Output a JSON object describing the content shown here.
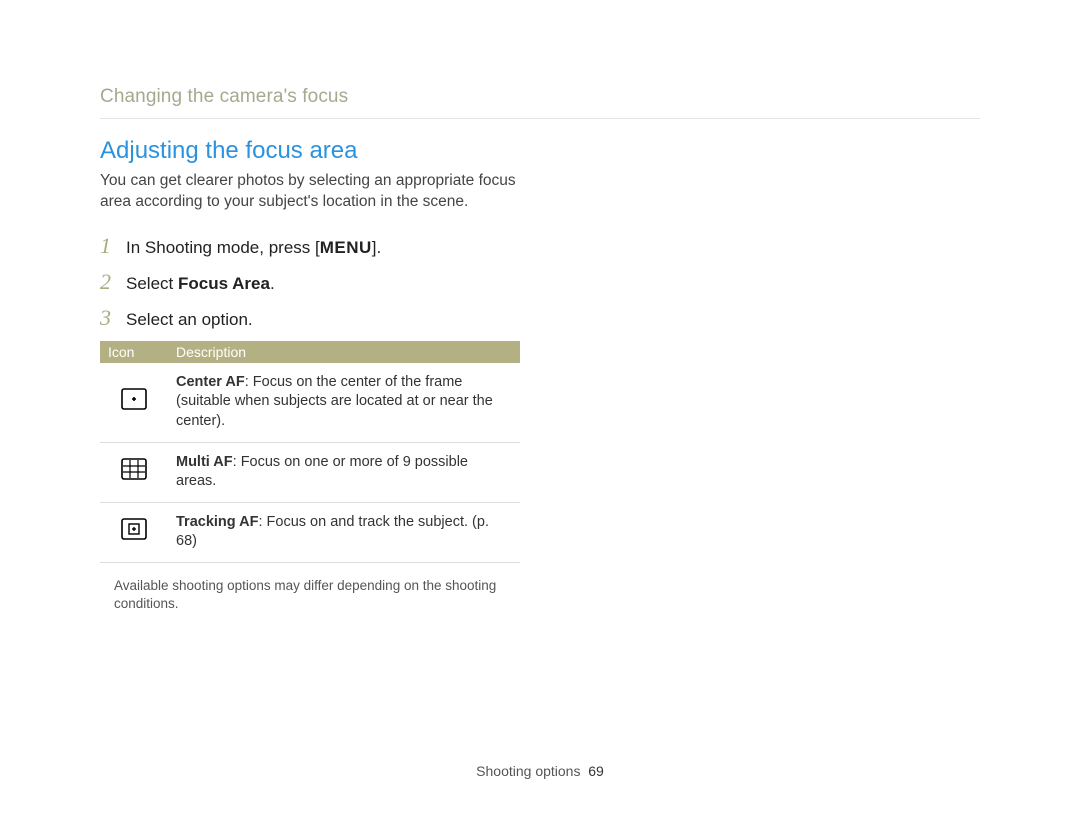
{
  "breadcrumb": "Changing the camera's focus",
  "section_title": "Adjusting the focus area",
  "intro": "You can get clearer photos by selecting an appropriate focus area according to your subject's location in the scene.",
  "steps": {
    "s1": {
      "num": "1",
      "pre": "In Shooting mode, press [",
      "btn": "MENU",
      "post": "]."
    },
    "s2": {
      "num": "2",
      "pre": "Select ",
      "strong": "Focus Area",
      "post": "."
    },
    "s3": {
      "num": "3",
      "pre": "Select an option."
    }
  },
  "table": {
    "head_icon": "Icon",
    "head_desc": "Description",
    "rows": {
      "r1": {
        "icon_name": "center-af-icon",
        "strong": "Center AF",
        "rest": ": Focus on the center of the frame (suitable when subjects are located at or near the center)."
      },
      "r2": {
        "icon_name": "multi-af-icon",
        "strong": "Multi AF",
        "rest": ": Focus on one or more of 9 possible areas."
      },
      "r3": {
        "icon_name": "tracking-af-icon",
        "strong": "Tracking AF",
        "rest": ": Focus on and track the subject. (p. 68)"
      }
    }
  },
  "note": "Available shooting options may differ depending on the shooting conditions.",
  "footer": {
    "label": "Shooting options",
    "page": "69"
  }
}
